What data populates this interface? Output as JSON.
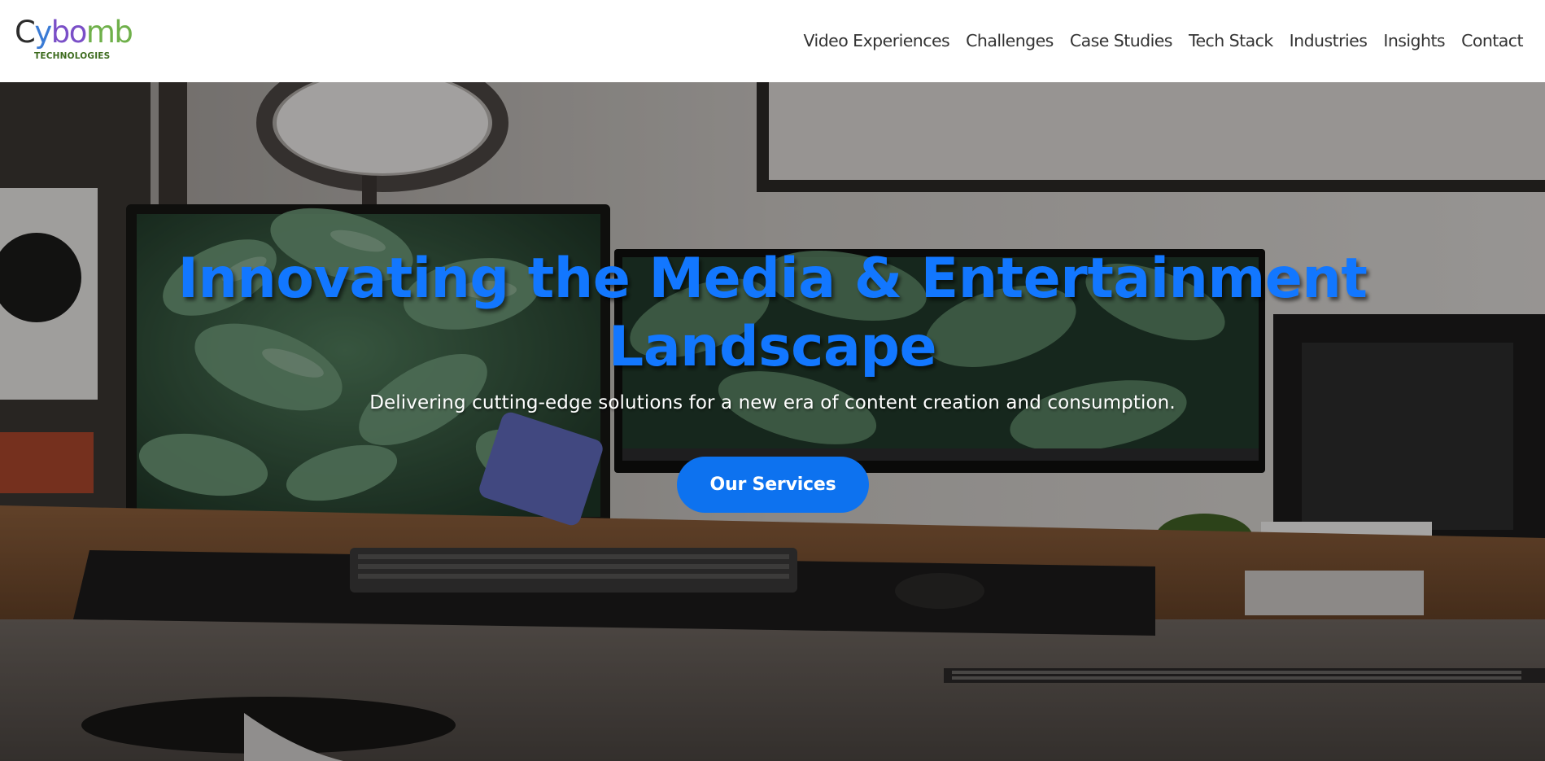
{
  "brand": {
    "logo_letters": [
      "C",
      "y",
      "bo",
      "mb"
    ],
    "logo_subtitle": "TECHNOLOGIES",
    "colors": {
      "dark": "#2c2c2c",
      "blue": "#3a7bd5",
      "purple": "#7a4fc7",
      "green": "#6fb04a",
      "sub": "#3d6b1e"
    }
  },
  "nav": {
    "items": [
      {
        "label": "Video Experiences"
      },
      {
        "label": "Challenges"
      },
      {
        "label": "Case Studies"
      },
      {
        "label": "Tech Stack"
      },
      {
        "label": "Industries"
      },
      {
        "label": "Insights"
      },
      {
        "label": "Contact"
      }
    ]
  },
  "hero": {
    "title_line1": "Innovating the Media & Entertainment",
    "title_line2": "Landscape",
    "subtitle": "Delivering cutting-edge solutions for a new era of content creation and consumption.",
    "cta_label": "Our Services",
    "background_icon": "desk-setup-photo",
    "colors": {
      "title": "#1277ff",
      "button": "#0d72ef",
      "subtitle": "#ffffff"
    }
  }
}
